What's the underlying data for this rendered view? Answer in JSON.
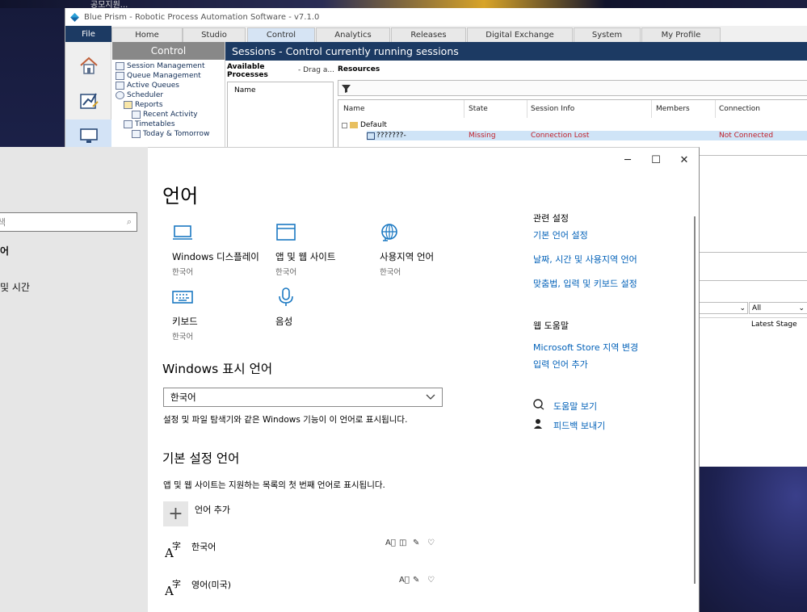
{
  "desktop": {
    "bg_title_text": "공모지원..."
  },
  "blueprism": {
    "title": "Blue Prism - Robotic Process Automation Software - v7.1.0",
    "file_label": "File",
    "tabs": [
      "Home",
      "Studio",
      "Control",
      "Analytics",
      "Releases",
      "Digital Exchange",
      "System",
      "My Profile"
    ],
    "active_tab": "Control",
    "side_icons": [
      "home-icon",
      "studio-icon",
      "control-icon"
    ],
    "tree_header": "Control",
    "tree_items": [
      {
        "label": "Session Management",
        "indent": 0
      },
      {
        "label": "Queue Management",
        "indent": 0
      },
      {
        "label": "Active Queues",
        "indent": 0
      },
      {
        "label": "Scheduler",
        "indent": 0
      },
      {
        "label": "Reports",
        "indent": 1
      },
      {
        "label": "Recent Activity",
        "indent": 2
      },
      {
        "label": "Timetables",
        "indent": 1
      },
      {
        "label": "Today & Tomorrow",
        "indent": 2
      }
    ],
    "sessions_header": "Sessions - Control currently running sessions",
    "available_processes_label": "Available\nProcesses",
    "drag_label": "- Drag a...",
    "processes_name_col": "Name",
    "resources_label": "Resources",
    "grid_columns": [
      "Name",
      "State",
      "Session Info",
      "Members",
      "Connection"
    ],
    "group_row": "Default",
    "resource_row": {
      "name": "???????-",
      "state": "Missing",
      "session_info": "Connection Lost",
      "members": "",
      "connection": "Not Connected"
    },
    "filter_all": "All",
    "latest_stage_label": "Latest Stage",
    "colors": {
      "navy": "#1c3a63",
      "error_red": "#c0202a"
    }
  },
  "settings_left": {
    "search_placeholder": "색",
    "item_bold": "어",
    "item_time": "및 시간"
  },
  "settings": {
    "window_controls": {
      "minimize": "─",
      "maximize": "☐",
      "close": "✕"
    },
    "page_title": "언어",
    "tiles": [
      {
        "icon": "laptop-icon",
        "title": "Windows 디스플레이",
        "subtitle": "한국어"
      },
      {
        "icon": "window-icon",
        "title": "앱 및 웹 사이트",
        "subtitle": "한국어"
      },
      {
        "icon": "globe-icon",
        "title": "사용지역 언어",
        "subtitle": "한국어"
      },
      {
        "icon": "keyboard-icon",
        "title": "키보드",
        "subtitle": "한국어"
      },
      {
        "icon": "microphone-icon",
        "title": "음성",
        "subtitle": ""
      }
    ],
    "display_language_heading": "Windows 표시 언어",
    "display_language_value": "한국어",
    "display_language_hint": "설정 및 파일 탐색기와 같은 Windows 기능이 이 언어로 표시됩니다.",
    "preferred_heading": "기본 설정 언어",
    "preferred_hint": "앱 및 웹 사이트는 지원하는 목록의 첫 번째 언어로 표시됩니다.",
    "add_language_label": "언어 추가",
    "languages": [
      {
        "name": "한국어",
        "capabilities": [
          "display-language-cap-icon",
          "tts-cap-icon",
          "handwriting-cap-icon",
          "speech-cap-icon"
        ]
      },
      {
        "name": "영어(미국)",
        "capabilities": [
          "display-language-cap-icon",
          "handwriting-cap-icon",
          "speech-cap-icon"
        ]
      }
    ],
    "related_heading": "관련 설정",
    "related_links": [
      "기본 언어 설정",
      "날짜, 시간 및 사용지역 언어",
      "맞춤법, 입력 및 키보드 설정"
    ],
    "web_help_heading": "웹 도움말",
    "web_help_links": [
      "Microsoft Store 지역 변경",
      "입력 언어 추가"
    ],
    "help_label": "도움말 보기",
    "feedback_label": "피드백 보내기",
    "colors": {
      "accent": "#0060b8",
      "icon_blue": "#1a78c2"
    }
  }
}
